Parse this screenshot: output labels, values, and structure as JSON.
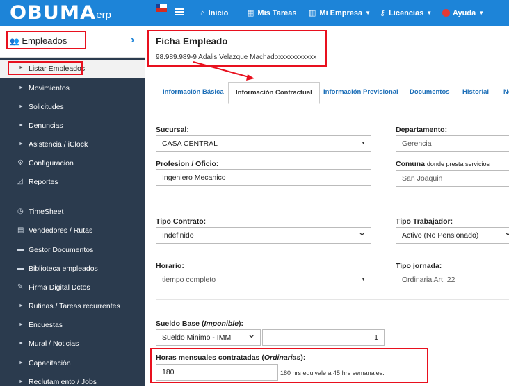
{
  "brand": {
    "logo": "OBUMA",
    "suffix": "erp"
  },
  "topnav": {
    "items": [
      {
        "icon": "home-icon",
        "label": "Inicio"
      },
      {
        "icon": "calendar-icon",
        "label": "Mis Tareas"
      },
      {
        "icon": "building-icon",
        "label": "Mi Empresa"
      },
      {
        "icon": "key-icon",
        "label": "Licencias"
      },
      {
        "icon": "lifebuoy-icon",
        "label": "Ayuda"
      }
    ]
  },
  "sidebar": {
    "title": "Empleados",
    "active": "Listar Empleados",
    "items": [
      {
        "label": "Movimientos"
      },
      {
        "label": "Solicitudes"
      },
      {
        "label": "Denuncias"
      },
      {
        "label": "Asistencia / iClock"
      },
      {
        "label": "Configuracion"
      },
      {
        "label": "Reportes"
      }
    ],
    "modules": [
      {
        "label": "TimeSheet"
      },
      {
        "label": "Vendedores / Rutas"
      },
      {
        "label": "Gestor Documentos"
      },
      {
        "label": "Biblioteca empleados"
      },
      {
        "label": "Firma Digital Dctos"
      },
      {
        "label": "Rutinas / Tareas recurrentes"
      },
      {
        "label": "Encuestas"
      },
      {
        "label": "Mural / Noticias"
      },
      {
        "label": "Capacitación"
      },
      {
        "label": "Reclutamiento / Jobs"
      }
    ]
  },
  "ficha": {
    "title": "Ficha Empleado",
    "employee": "98.989.989-9 Adalis Velazque Machadoxxxxxxxxxxx"
  },
  "tabs": [
    "Información Básica",
    "Información Contractual",
    "Información Previsional",
    "Documentos",
    "Historial",
    "No"
  ],
  "form": {
    "sucursal_label": "Sucursal:",
    "sucursal_value": "CASA CENTRAL",
    "departamento_label": "Departamento:",
    "departamento_value": "Gerencia",
    "profesion_label": "Profesion / Oficio:",
    "profesion_value": "Ingeniero Mecanico",
    "comuna_label": "Comuna",
    "comuna_hint": "donde presta servicios",
    "comuna_value": "San Joaquin",
    "tipo_contrato_label": "Tipo Contrato:",
    "tipo_contrato_value": "Indefinido",
    "tipo_trabajador_label": "Tipo Trabajador:",
    "tipo_trabajador_value": "Activo (No Pensionado)",
    "horario_label": "Horario:",
    "horario_value": "tiempo completo",
    "tipo_jornada_label": "Tipo jornada:",
    "tipo_jornada_value": "Ordinaria Art. 22",
    "sueldo_label": "Sueldo Base",
    "sueldo_hint": "Imponible",
    "sueldo_tipo_value": "Sueldo Minimo - IMM",
    "sueldo_monto_value": "1",
    "horas_label": "Horas mensuales contratadas",
    "horas_hint": "Ordinarias",
    "horas_value": "180",
    "horas_equiv": "180 hrs equivale a 45 hrs semanales."
  },
  "colors": {
    "topbar": "#1d84d8",
    "sidebar": "#2b3b4e",
    "highlight": "#e8101e"
  }
}
